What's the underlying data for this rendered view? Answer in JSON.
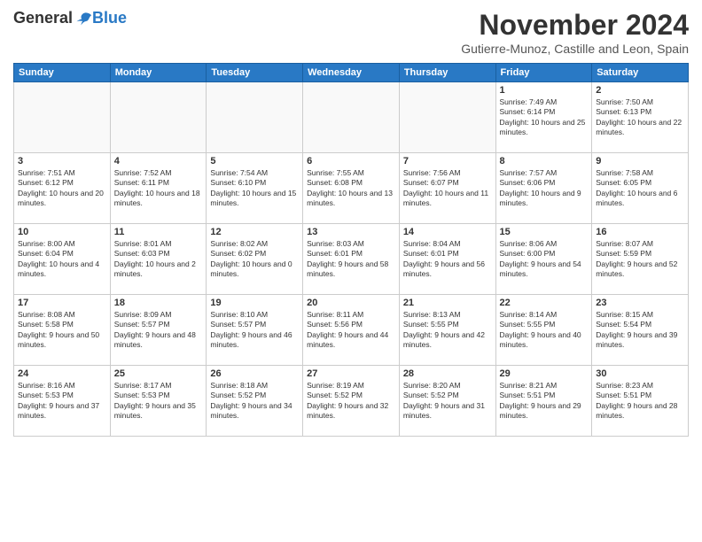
{
  "header": {
    "logo_general": "General",
    "logo_blue": "Blue",
    "month_title": "November 2024",
    "location": "Gutierre-Munoz, Castille and Leon, Spain"
  },
  "days_of_week": [
    "Sunday",
    "Monday",
    "Tuesday",
    "Wednesday",
    "Thursday",
    "Friday",
    "Saturday"
  ],
  "weeks": [
    [
      {
        "day": "",
        "info": ""
      },
      {
        "day": "",
        "info": ""
      },
      {
        "day": "",
        "info": ""
      },
      {
        "day": "",
        "info": ""
      },
      {
        "day": "",
        "info": ""
      },
      {
        "day": "1",
        "info": "Sunrise: 7:49 AM\nSunset: 6:14 PM\nDaylight: 10 hours and 25 minutes."
      },
      {
        "day": "2",
        "info": "Sunrise: 7:50 AM\nSunset: 6:13 PM\nDaylight: 10 hours and 22 minutes."
      }
    ],
    [
      {
        "day": "3",
        "info": "Sunrise: 7:51 AM\nSunset: 6:12 PM\nDaylight: 10 hours and 20 minutes."
      },
      {
        "day": "4",
        "info": "Sunrise: 7:52 AM\nSunset: 6:11 PM\nDaylight: 10 hours and 18 minutes."
      },
      {
        "day": "5",
        "info": "Sunrise: 7:54 AM\nSunset: 6:10 PM\nDaylight: 10 hours and 15 minutes."
      },
      {
        "day": "6",
        "info": "Sunrise: 7:55 AM\nSunset: 6:08 PM\nDaylight: 10 hours and 13 minutes."
      },
      {
        "day": "7",
        "info": "Sunrise: 7:56 AM\nSunset: 6:07 PM\nDaylight: 10 hours and 11 minutes."
      },
      {
        "day": "8",
        "info": "Sunrise: 7:57 AM\nSunset: 6:06 PM\nDaylight: 10 hours and 9 minutes."
      },
      {
        "day": "9",
        "info": "Sunrise: 7:58 AM\nSunset: 6:05 PM\nDaylight: 10 hours and 6 minutes."
      }
    ],
    [
      {
        "day": "10",
        "info": "Sunrise: 8:00 AM\nSunset: 6:04 PM\nDaylight: 10 hours and 4 minutes."
      },
      {
        "day": "11",
        "info": "Sunrise: 8:01 AM\nSunset: 6:03 PM\nDaylight: 10 hours and 2 minutes."
      },
      {
        "day": "12",
        "info": "Sunrise: 8:02 AM\nSunset: 6:02 PM\nDaylight: 10 hours and 0 minutes."
      },
      {
        "day": "13",
        "info": "Sunrise: 8:03 AM\nSunset: 6:01 PM\nDaylight: 9 hours and 58 minutes."
      },
      {
        "day": "14",
        "info": "Sunrise: 8:04 AM\nSunset: 6:01 PM\nDaylight: 9 hours and 56 minutes."
      },
      {
        "day": "15",
        "info": "Sunrise: 8:06 AM\nSunset: 6:00 PM\nDaylight: 9 hours and 54 minutes."
      },
      {
        "day": "16",
        "info": "Sunrise: 8:07 AM\nSunset: 5:59 PM\nDaylight: 9 hours and 52 minutes."
      }
    ],
    [
      {
        "day": "17",
        "info": "Sunrise: 8:08 AM\nSunset: 5:58 PM\nDaylight: 9 hours and 50 minutes."
      },
      {
        "day": "18",
        "info": "Sunrise: 8:09 AM\nSunset: 5:57 PM\nDaylight: 9 hours and 48 minutes."
      },
      {
        "day": "19",
        "info": "Sunrise: 8:10 AM\nSunset: 5:57 PM\nDaylight: 9 hours and 46 minutes."
      },
      {
        "day": "20",
        "info": "Sunrise: 8:11 AM\nSunset: 5:56 PM\nDaylight: 9 hours and 44 minutes."
      },
      {
        "day": "21",
        "info": "Sunrise: 8:13 AM\nSunset: 5:55 PM\nDaylight: 9 hours and 42 minutes."
      },
      {
        "day": "22",
        "info": "Sunrise: 8:14 AM\nSunset: 5:55 PM\nDaylight: 9 hours and 40 minutes."
      },
      {
        "day": "23",
        "info": "Sunrise: 8:15 AM\nSunset: 5:54 PM\nDaylight: 9 hours and 39 minutes."
      }
    ],
    [
      {
        "day": "24",
        "info": "Sunrise: 8:16 AM\nSunset: 5:53 PM\nDaylight: 9 hours and 37 minutes."
      },
      {
        "day": "25",
        "info": "Sunrise: 8:17 AM\nSunset: 5:53 PM\nDaylight: 9 hours and 35 minutes."
      },
      {
        "day": "26",
        "info": "Sunrise: 8:18 AM\nSunset: 5:52 PM\nDaylight: 9 hours and 34 minutes."
      },
      {
        "day": "27",
        "info": "Sunrise: 8:19 AM\nSunset: 5:52 PM\nDaylight: 9 hours and 32 minutes."
      },
      {
        "day": "28",
        "info": "Sunrise: 8:20 AM\nSunset: 5:52 PM\nDaylight: 9 hours and 31 minutes."
      },
      {
        "day": "29",
        "info": "Sunrise: 8:21 AM\nSunset: 5:51 PM\nDaylight: 9 hours and 29 minutes."
      },
      {
        "day": "30",
        "info": "Sunrise: 8:23 AM\nSunset: 5:51 PM\nDaylight: 9 hours and 28 minutes."
      }
    ]
  ]
}
